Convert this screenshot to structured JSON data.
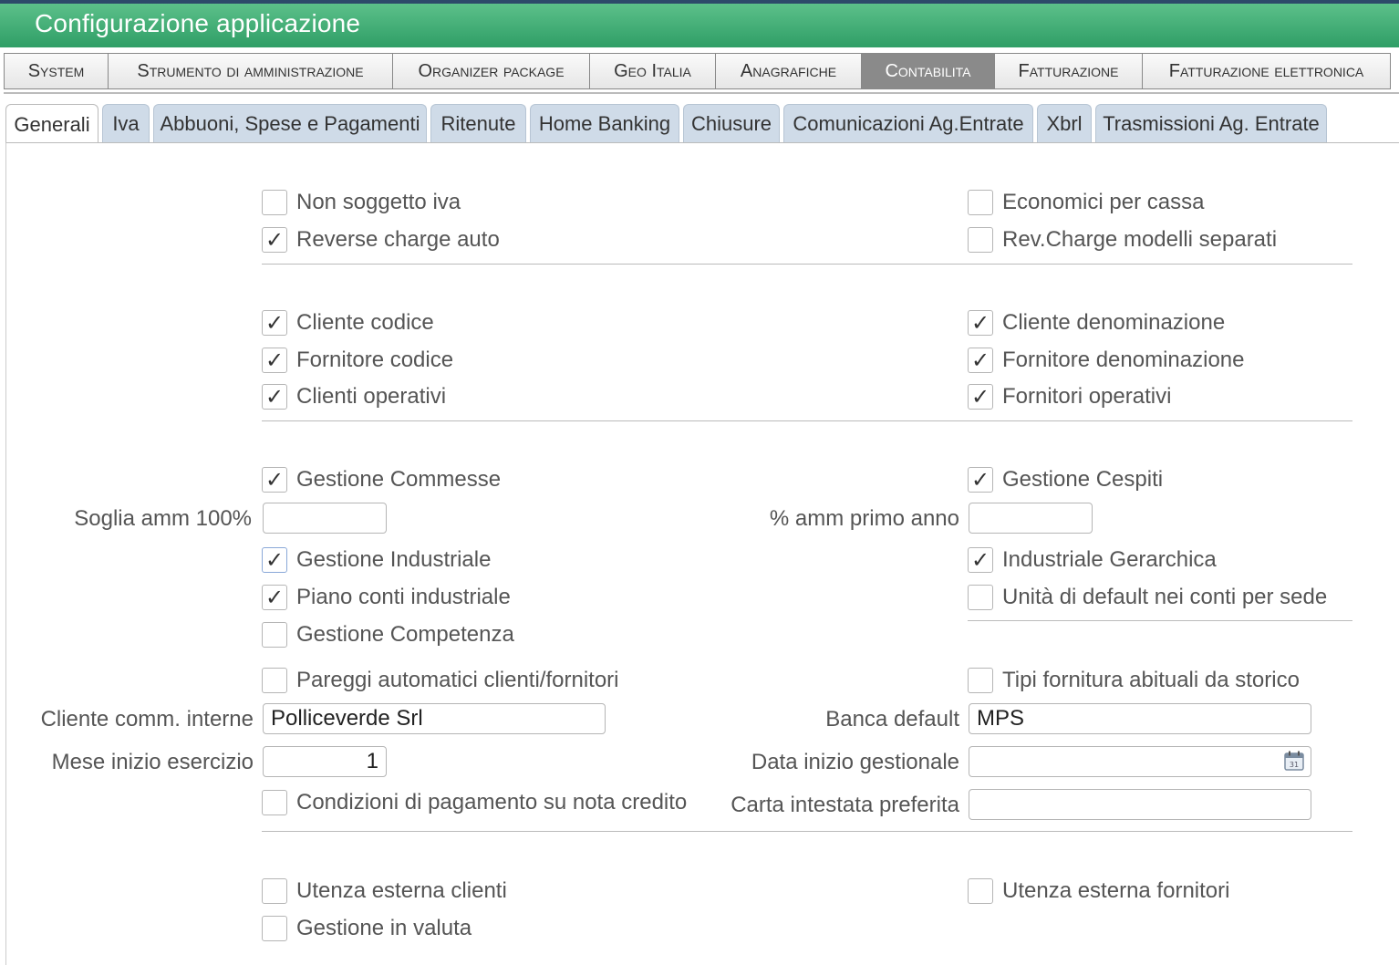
{
  "app": {
    "title": "Configurazione applicazione"
  },
  "topnav": [
    {
      "label": "System",
      "active": false
    },
    {
      "label": "Strumento di amministrazione",
      "active": false
    },
    {
      "label": "Organizer package",
      "active": false
    },
    {
      "label": "Geo Italia",
      "active": false
    },
    {
      "label": "Anagrafiche",
      "active": false
    },
    {
      "label": "Contabilita",
      "active": true
    },
    {
      "label": "Fatturazione",
      "active": false
    },
    {
      "label": "Fatturazione elettronica",
      "active": false
    }
  ],
  "subtabs": [
    {
      "label": "Generali",
      "active": true
    },
    {
      "label": "Iva",
      "active": false
    },
    {
      "label": "Abbuoni, Spese e Pagamenti",
      "active": false
    },
    {
      "label": "Ritenute",
      "active": false
    },
    {
      "label": "Home Banking",
      "active": false
    },
    {
      "label": "Chiusure",
      "active": false
    },
    {
      "label": "Comunicazioni Ag.Entrate",
      "active": false
    },
    {
      "label": "Xbrl",
      "active": false
    },
    {
      "label": "Trasmissioni Ag. Entrate",
      "active": false
    }
  ],
  "checkboxes": {
    "non_soggetto_iva": {
      "label": "Non soggetto iva",
      "checked": false
    },
    "economici_per_cassa": {
      "label": "Economici per cassa",
      "checked": false
    },
    "reverse_charge_auto": {
      "label": "Reverse charge auto",
      "checked": true
    },
    "rev_charge_modelli": {
      "label": "Rev.Charge modelli separati",
      "checked": false
    },
    "cliente_codice": {
      "label": "Cliente codice",
      "checked": true
    },
    "cliente_denominazione": {
      "label": "Cliente denominazione",
      "checked": true
    },
    "fornitore_codice": {
      "label": "Fornitore codice",
      "checked": true
    },
    "fornitore_denominazione": {
      "label": "Fornitore denominazione",
      "checked": true
    },
    "clienti_operativi": {
      "label": "Clienti operativi",
      "checked": true
    },
    "fornitori_operativi": {
      "label": "Fornitori operativi",
      "checked": true
    },
    "gestione_commesse": {
      "label": "Gestione Commesse",
      "checked": true
    },
    "gestione_cespiti": {
      "label": "Gestione Cespiti",
      "checked": true
    },
    "gestione_industriale": {
      "label": "Gestione Industriale",
      "checked": true
    },
    "industriale_gerarchica": {
      "label": "Industriale Gerarchica",
      "checked": true
    },
    "piano_conti_industriale": {
      "label": "Piano conti industriale",
      "checked": true
    },
    "unita_default": {
      "label": "Unità di default nei conti per sede",
      "checked": false
    },
    "gestione_competenza": {
      "label": "Gestione Competenza",
      "checked": false
    },
    "pareggi_automatici": {
      "label": "Pareggi automatici clienti/fornitori",
      "checked": false
    },
    "tipi_fornitura": {
      "label": "Tipi fornitura abituali da storico",
      "checked": false
    },
    "condizioni_pagamento": {
      "label": "Condizioni di pagamento su nota credito",
      "checked": false
    },
    "utenza_clienti": {
      "label": "Utenza esterna clienti",
      "checked": false
    },
    "utenza_fornitori": {
      "label": "Utenza esterna fornitori",
      "checked": false
    },
    "gestione_valuta": {
      "label": "Gestione in valuta",
      "checked": false
    }
  },
  "fields": {
    "soglia_amm": {
      "label": "Soglia amm 100%",
      "value": ""
    },
    "amm_primo_anno": {
      "label": "% amm primo anno",
      "value": ""
    },
    "cliente_comm": {
      "label": "Cliente comm. interne",
      "value": "Polliceverde Srl"
    },
    "banca_default": {
      "label": "Banca default",
      "value": "MPS"
    },
    "mese_inizio": {
      "label": "Mese inizio esercizio",
      "value": "1"
    },
    "data_inizio": {
      "label": "Data inizio gestionale",
      "value": ""
    },
    "carta_intestata": {
      "label": "Carta intestata preferita",
      "value": ""
    }
  },
  "check_glyph": "✓",
  "colors": {
    "title_green": "#3aa870",
    "active_tab": "#8a8a8a",
    "subtab_bg": "#cfdbe8"
  }
}
